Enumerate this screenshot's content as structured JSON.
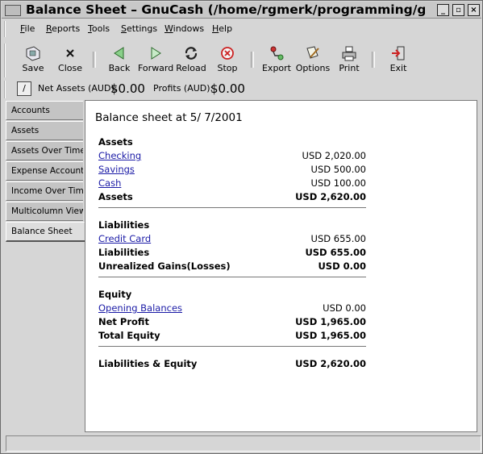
{
  "window": {
    "title": "Balance Sheet – GnuCash (/home/rgmerk/programming/gnc/gnucash)"
  },
  "menu": [
    {
      "label": "File",
      "u": "F",
      "rest": "ile"
    },
    {
      "label": "Reports",
      "u": "R",
      "rest": "eports"
    },
    {
      "label": "Tools",
      "u": "T",
      "rest": "ools"
    },
    {
      "label": "Settings",
      "u": "S",
      "rest": "ettings"
    },
    {
      "label": "Windows",
      "u": "W",
      "rest": "indows"
    },
    {
      "label": "Help",
      "u": "H",
      "rest": "elp"
    }
  ],
  "toolbar": {
    "save": "Save",
    "close": "Close",
    "back": "Back",
    "forward": "Forward",
    "reload": "Reload",
    "stop": "Stop",
    "export": "Export",
    "options": "Options",
    "print": "Print",
    "exit": "Exit"
  },
  "summary": {
    "net_assets_label": "Net Assets (AUD):",
    "net_assets_value": "$0.00",
    "profits_label": "Profits (AUD):",
    "profits_value": "$0.00"
  },
  "tabs": [
    "Accounts",
    "Assets",
    "Assets Over Time",
    "Expense Accounts",
    "Income Over Time",
    "Multicolumn View",
    "Balance Sheet"
  ],
  "report": {
    "title": "Balance sheet at 5/ 7/2001",
    "assets_header": "Assets",
    "checking": "Checking",
    "checking_amt": "USD 2,020.00",
    "savings": "Savings",
    "savings_amt": "USD 500.00",
    "cash": "Cash",
    "cash_amt": "USD 100.00",
    "assets_total_label": "Assets",
    "assets_total": "USD 2,620.00",
    "liabilities_header": "Liabilities",
    "credit_card": "Credit Card",
    "credit_card_amt": "USD 655.00",
    "liabilities_total_label": "Liabilities",
    "liabilities_total": "USD 655.00",
    "unrealized_label": "Unrealized Gains(Losses)",
    "unrealized": "USD 0.00",
    "equity_header": "Equity",
    "opening": "Opening Balances",
    "opening_amt": "USD 0.00",
    "net_profit_label": "Net Profit",
    "net_profit": "USD 1,965.00",
    "total_equity_label": "Total Equity",
    "total_equity": "USD 1,965.00",
    "le_label": "Liabilities & Equity",
    "le_total": "USD 2,620.00"
  },
  "colors": {
    "link": "#1a1aa6",
    "window_bg": "#d6d6d6",
    "content_bg": "#ffffff"
  }
}
